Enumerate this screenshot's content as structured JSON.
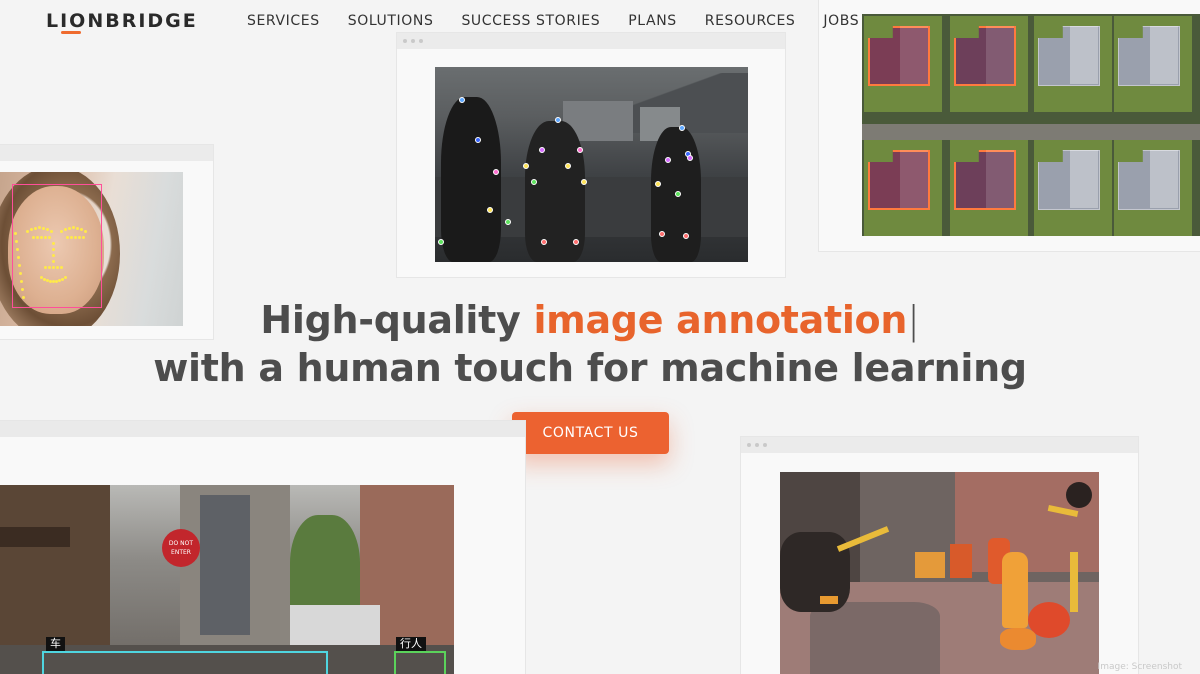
{
  "brand": {
    "logo_text": "LIONBRIDGE",
    "accent_color": "#ec6230"
  },
  "nav": {
    "items": [
      {
        "label": "SERVICES"
      },
      {
        "label": "SOLUTIONS"
      },
      {
        "label": "SUCCESS STORIES"
      },
      {
        "label": "PLANS"
      },
      {
        "label": "RESOURCES"
      },
      {
        "label": "JOBS"
      }
    ]
  },
  "hero": {
    "headline_prefix": "High-quality ",
    "headline_highlight": "image annotation",
    "headline_cursor": "|",
    "headline_line2": "with a human touch for machine learning",
    "cta_label": "CONTACT US"
  },
  "images": {
    "street_tag_car": "车",
    "street_tag_pedestrian": "行人",
    "street_sign_text": "DO NOT ENTER"
  },
  "credit": "Image: Screenshot"
}
